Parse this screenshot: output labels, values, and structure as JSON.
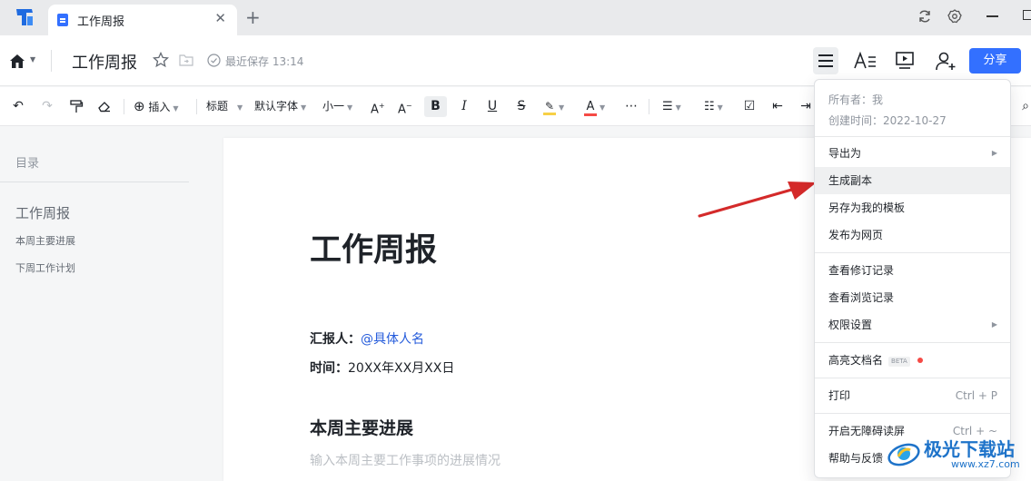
{
  "tab": {
    "title": "工作周报"
  },
  "header": {
    "doc_title": "工作周报",
    "saved_text": "最近保存 13:14",
    "share_label": "分享"
  },
  "toolbar": {
    "insert_label": "插入",
    "heading_label": "标题",
    "font_label": "默认字体",
    "size_label": "小一",
    "bold_label": "B",
    "italic_label": "I",
    "underline_label": "U",
    "strike_label": "S",
    "font_color_label": "A",
    "highlight_color": "#f7d046",
    "font_color": "#f54a45"
  },
  "toc": {
    "title": "目录",
    "h1": "工作周报",
    "items": [
      "本周主要进展",
      "下周工作计划"
    ]
  },
  "document": {
    "title": "工作周报",
    "reporter_label": "汇报人：",
    "reporter_value": "@具体人名",
    "time_label": "时间：",
    "time_value": "20XX年XX月XX日",
    "section_title": "本周主要进展",
    "placeholder": "输入本周主要工作事项的进展情况"
  },
  "menu": {
    "owner": "所有者：我",
    "created": "创建时间：2022-10-27",
    "export": "导出为",
    "duplicate": "生成副本",
    "save_template": "另存为我的模板",
    "publish": "发布为网页",
    "revision_history": "查看修订记录",
    "view_history": "查看浏览记录",
    "permissions": "权限设置",
    "highlight_name": "高亮文档名",
    "beta": "BETA",
    "print": "打印",
    "print_shortcut": "Ctrl + P",
    "accessibility": "开启无障碍读屏",
    "accessibility_shortcut": "Ctrl + ~",
    "help": "帮助与反馈"
  },
  "watermark": {
    "text": "极光下载站",
    "url": "www.xz7.com"
  },
  "colors": {
    "accent": "#3370ff",
    "arrow": "#d42a2a"
  }
}
